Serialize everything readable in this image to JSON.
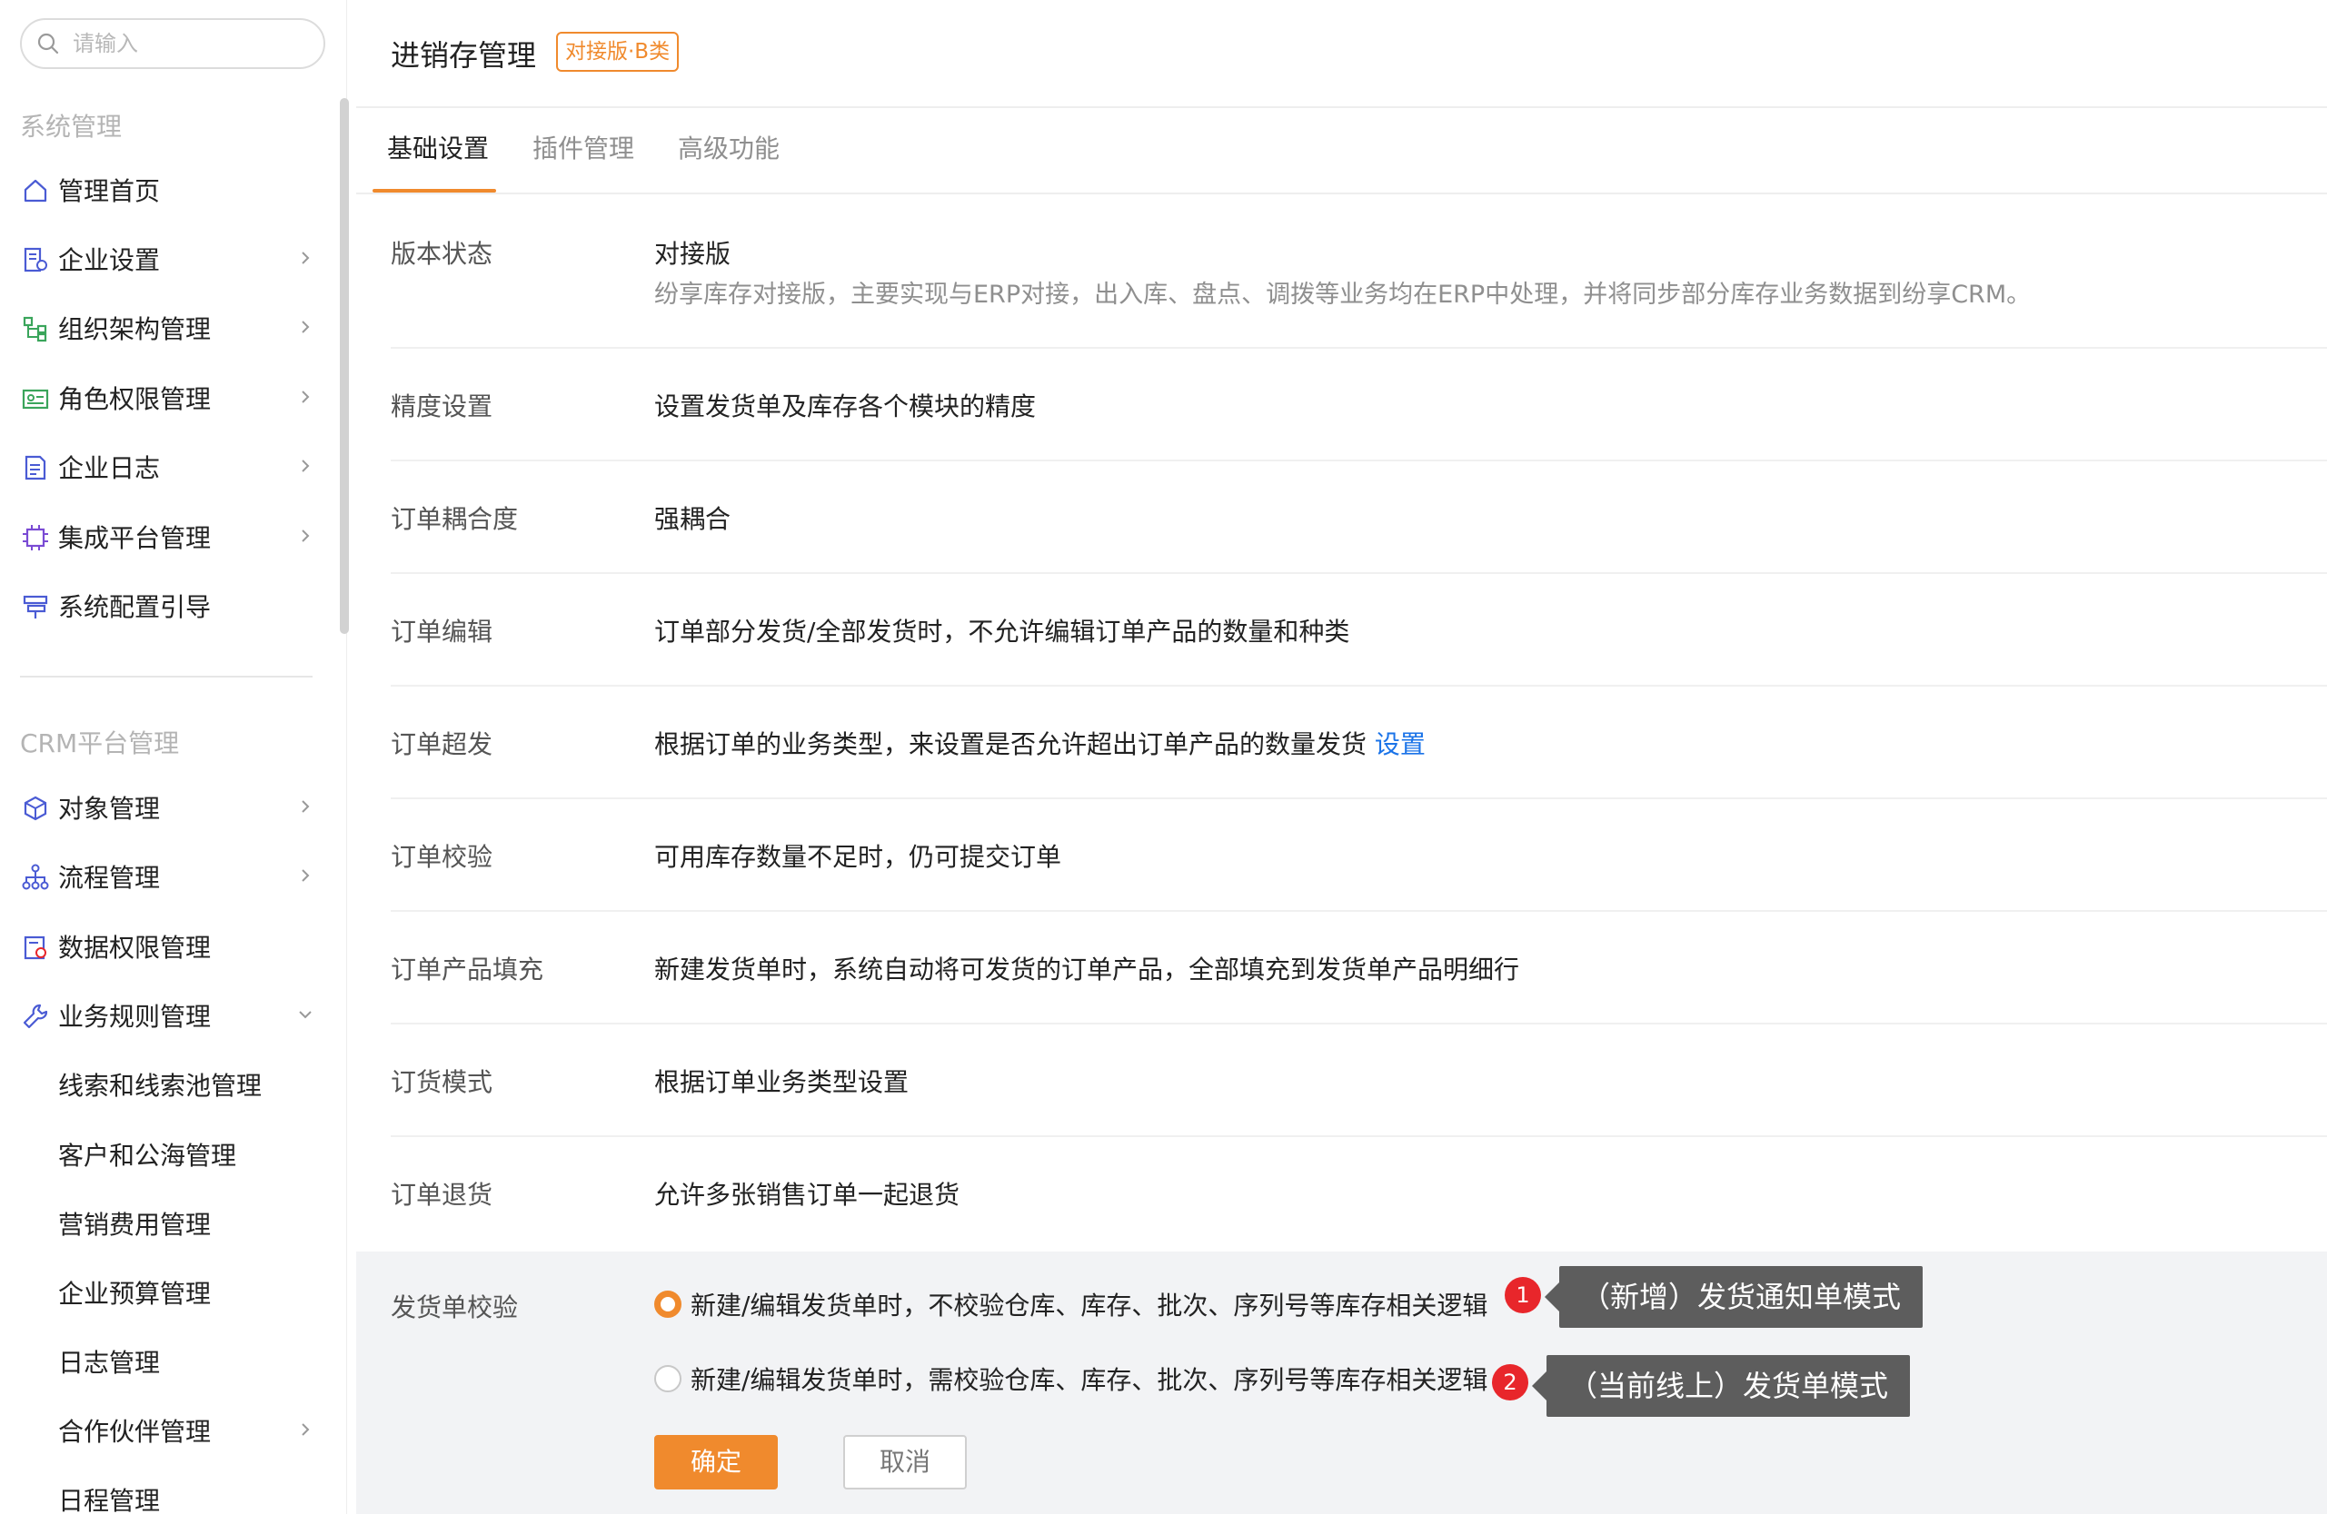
{
  "sidebar": {
    "search_placeholder": "请输入",
    "section1_title": "系统管理",
    "section1_items": [
      {
        "label": "管理首页",
        "icon": "home-icon"
      },
      {
        "label": "企业设置",
        "icon": "enterprise-icon"
      },
      {
        "label": "组织架构管理",
        "icon": "org-tree-icon"
      },
      {
        "label": "角色权限管理",
        "icon": "id-card-icon"
      },
      {
        "label": "企业日志",
        "icon": "log-icon"
      },
      {
        "label": "集成平台管理",
        "icon": "chip-icon"
      },
      {
        "label": "系统配置引导",
        "icon": "guide-icon"
      }
    ],
    "section2_title": "CRM平台管理",
    "section2_items": [
      {
        "label": "对象管理",
        "icon": "cube-icon"
      },
      {
        "label": "流程管理",
        "icon": "flow-icon"
      },
      {
        "label": "数据权限管理",
        "icon": "data-permission-icon"
      },
      {
        "label": "业务规则管理",
        "icon": "wrench-icon"
      }
    ],
    "sub_items": [
      {
        "label": "线索和线索池管理"
      },
      {
        "label": "客户和公海管理"
      },
      {
        "label": "营销费用管理"
      },
      {
        "label": "企业预算管理"
      },
      {
        "label": "日志管理"
      },
      {
        "label": "合作伙伴管理"
      },
      {
        "label": "日程管理"
      }
    ]
  },
  "header": {
    "title": "进销存管理",
    "badge": "对接版·B类"
  },
  "tabs": [
    {
      "label": "基础设置",
      "active": true
    },
    {
      "label": "插件管理",
      "active": false
    },
    {
      "label": "高级功能",
      "active": false
    }
  ],
  "settings": [
    {
      "label": "版本状态",
      "value": "对接版",
      "desc": "纷享库存对接版，主要实现与ERP对接，出入库、盘点、调拨等业务均在ERP中处理，并将同步部分库存业务数据到纷享CRM。"
    },
    {
      "label": "精度设置",
      "value": "设置发货单及库存各个模块的精度"
    },
    {
      "label": "订单耦合度",
      "value": "强耦合"
    },
    {
      "label": "订单编辑",
      "value": "订单部分发货/全部发货时，不允许编辑订单产品的数量和种类"
    },
    {
      "label": "订单超发",
      "value": "根据订单的业务类型，来设置是否允许超出订单产品的数量发货",
      "link": "设置"
    },
    {
      "label": "订单校验",
      "value": "可用库存数量不足时，仍可提交订单"
    },
    {
      "label": "订单产品填充",
      "value": "新建发货单时，系统自动将可发货的订单产品，全部填充到发货单产品明细行"
    },
    {
      "label": "订货模式",
      "value": "根据订单业务类型设置"
    },
    {
      "label": "订单退货",
      "value": "允许多张销售订单一起退货"
    }
  ],
  "delivery_check": {
    "label": "发货单校验",
    "options": [
      {
        "label": "新建/编辑发货单时，不校验仓库、库存、批次、序列号等库存相关逻辑",
        "checked": true,
        "badge": "1",
        "callout": "（新增）发货通知单模式"
      },
      {
        "label": "新建/编辑发货单时，需校验仓库、库存、批次、序列号等库存相关逻辑",
        "checked": false,
        "badge": "2",
        "callout": "（当前线上）发货单模式"
      }
    ],
    "confirm_label": "确定",
    "cancel_label": "取消"
  },
  "colors": {
    "accent": "#f08a2d",
    "link": "#1a73e8",
    "badge_red": "#e8262b",
    "callout_bg": "#5d5d5d",
    "section_bg": "#f2f3f5"
  }
}
